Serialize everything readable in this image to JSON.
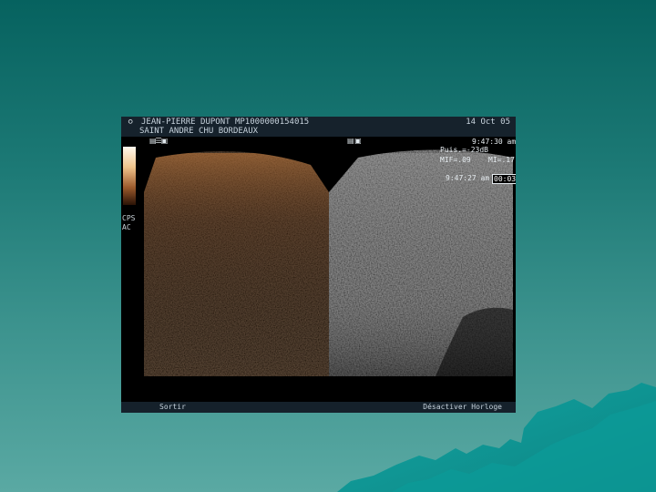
{
  "header": {
    "patient": "JEAN-PIERRE DUPONT  MP1000000154015",
    "hospital": "SAINT ANDRE CHU BORDEAUX",
    "date": "14 Oct 05"
  },
  "scale": {
    "labels": [
      "CPS",
      "AC"
    ]
  },
  "info": {
    "time_top": "9:47:30 am",
    "gain": "Puis.=-23dB",
    "mi": "MIF=.09",
    "mi2": "MI=.17",
    "time_bottom": "9:47:27 am",
    "timer": "00:03"
  },
  "footer": {
    "left_action": "Sortir",
    "right_action": "Désactiver Horloge"
  },
  "icons": {
    "logo": "probe-logo-icon",
    "mode_left": "contrast-mode-icon",
    "mode_right": "bmode-icon"
  },
  "colors": {
    "background_top": "#06625f",
    "background_bottom": "#5aa9a3",
    "contrast_tint": "#b8784a",
    "header_bar": "#16222c"
  }
}
